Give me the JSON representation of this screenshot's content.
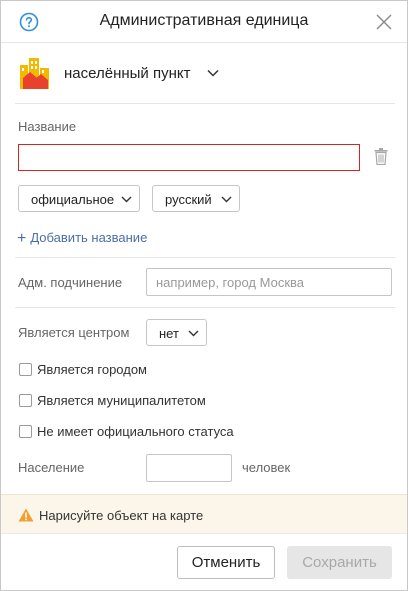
{
  "header": {
    "title": "Административная единица",
    "help_icon": "question-circle-icon",
    "close_icon": "close-icon"
  },
  "category": {
    "icon": "city-buildings-icon",
    "label": "населённый пункт"
  },
  "name_section": {
    "label": "Название",
    "value": "",
    "type_select": "официальное",
    "language_select": "русский",
    "add_name_link": "Добавить название"
  },
  "subordination": {
    "label": "Адм. подчинение",
    "placeholder": "например, город Москва"
  },
  "center": {
    "label": "Является центром",
    "value": "нет"
  },
  "checkboxes": {
    "is_city": "Является городом",
    "is_municipality": "Является муниципалитетом",
    "no_official_status": "Не имеет официального статуса"
  },
  "population": {
    "label": "Население",
    "value": "",
    "unit": "человек"
  },
  "warning": {
    "text": "Нарисуйте объект на карте"
  },
  "footer": {
    "cancel_label": "Отменить",
    "save_label": "Сохранить"
  },
  "colors": {
    "error_border": "#d92424",
    "link": "#4a6fa5",
    "warning_bg": "#fcf6ea",
    "warning_icon": "#f0a030",
    "help_icon": "#2f8fd8"
  }
}
